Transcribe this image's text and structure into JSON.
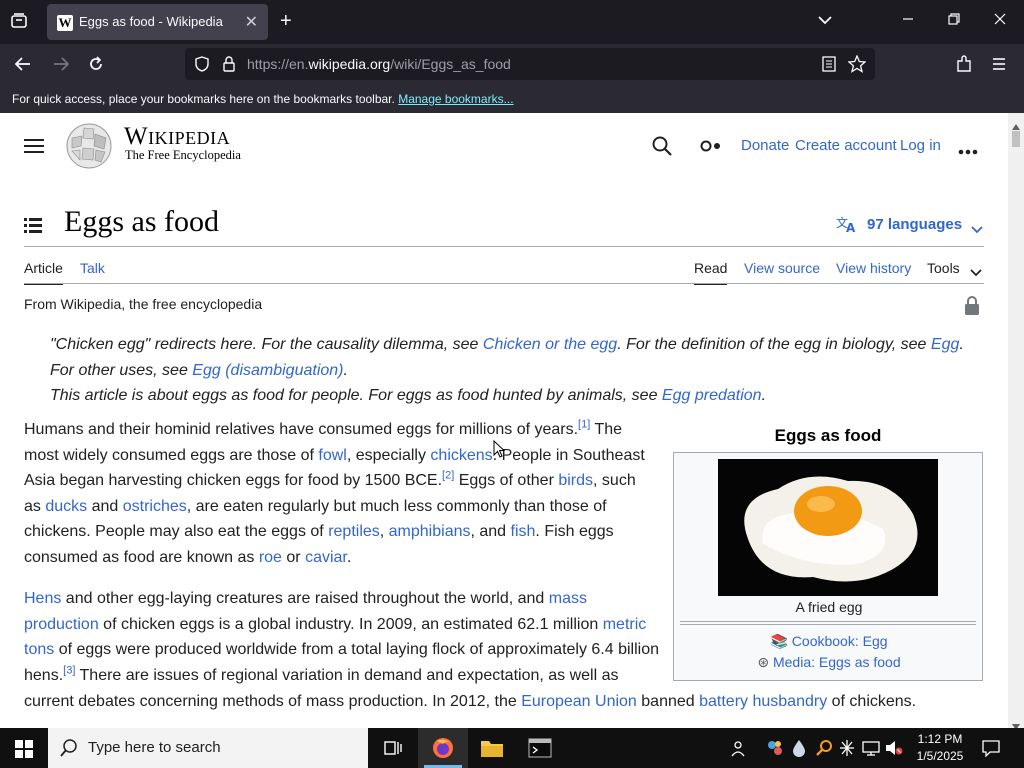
{
  "browser": {
    "tab_title": "Eggs as food - Wikipedia",
    "tab_favicon": "W",
    "url_prefix": "https://en.",
    "url_domain": "wikipedia.org",
    "url_path": "/wiki/Eggs_as_food",
    "bookmarks_text": "For quick access, place your bookmarks here on the bookmarks toolbar.",
    "bookmarks_link": "Manage bookmarks..."
  },
  "wiki": {
    "wordmark": "Wikipedia",
    "tagline": "The Free Encyclopedia",
    "header_links": [
      "Donate",
      "Create account",
      "Log in"
    ],
    "page_title": "Eggs as food",
    "languages": "97 languages",
    "tabs_left": [
      "Article",
      "Talk"
    ],
    "tabs_right": [
      "Read",
      "View source",
      "View history",
      "Tools"
    ],
    "from_line": "From Wikipedia, the free encyclopedia"
  },
  "hatnotes": {
    "line1_a": "\"Chicken egg\" redirects here. For the causality dilemma, see ",
    "line1_link": "Chicken or the egg",
    "line1_b": ". For the definition of the egg in biology, see ",
    "line1_link2": "Egg",
    "line1_c": ".",
    "line2_a": "For other uses, see ",
    "line2_link": "Egg (disambiguation)",
    "line2_b": ".",
    "line3_a": "This article is about eggs as food for people. For eggs as food hunted by animals, see ",
    "line3_link": "Egg predation",
    "line3_b": "."
  },
  "infobox": {
    "title": "Eggs as food",
    "caption": "A fried egg",
    "link1": "Cookbook: Egg",
    "link2": "Media: Eggs as food"
  },
  "para1": {
    "l1a": "Humans and their hominid relatives have consumed eggs for millions of years.",
    "l1ref": "[1]",
    "l1b": " The",
    "l2a": "most widely consumed eggs are those of ",
    "l2link1": "fowl",
    "l2b": ", especially ",
    "l2link2": "chickens",
    "l2c": ". People in Southeast",
    "l3a": "Asia began harvesting chicken eggs for food by 1500 BCE.",
    "l3ref": "[2]",
    "l3b": " Eggs of other ",
    "l3link": "birds",
    "l3c": ", such",
    "l4a": "as ",
    "l4link1": "ducks",
    "l4b": " and ",
    "l4link2": "ostriches",
    "l4c": ", are eaten regularly but much less commonly than those of",
    "l5a": "chickens. People may also eat the eggs of ",
    "l5link1": "reptiles",
    "l5b": ", ",
    "l5link2": "amphibians",
    "l5c": ", and ",
    "l5link3": "fish",
    "l5d": ". Fish eggs",
    "l6a": "consumed as food are known as ",
    "l6link1": "roe",
    "l6b": " or ",
    "l6link2": "caviar",
    "l6c": "."
  },
  "para2": {
    "l1link1": "Hens",
    "l1a": " and other egg-laying creatures are raised throughout the world, and ",
    "l1link2": "mass",
    "l2link": "production",
    "l2a": " of chicken eggs is a global industry. In 2009, an estimated 62.1 million ",
    "l2link2": "metric",
    "l3link": "tons",
    "l3a": " of eggs were produced worldwide from a total laying flock of approximately 6.4 billion",
    "l4a": "hens.",
    "l4ref": "[3]",
    "l4b": " There are issues of regional variation in demand and expectation, as well as",
    "l5a": "current debates concerning methods of mass production. In 2012, the ",
    "l5link1": "European Union",
    "l5b": " banned ",
    "l5link2": "battery husbandry",
    "l5c": " of chickens."
  },
  "taskbar": {
    "search_placeholder": "Type here to search",
    "time": "1:12 PM",
    "date": "1/5/2025"
  },
  "colors": {
    "link": "#3366cc",
    "chrome_dark": "#1c1b22",
    "chrome_mid": "#2b2a33"
  }
}
